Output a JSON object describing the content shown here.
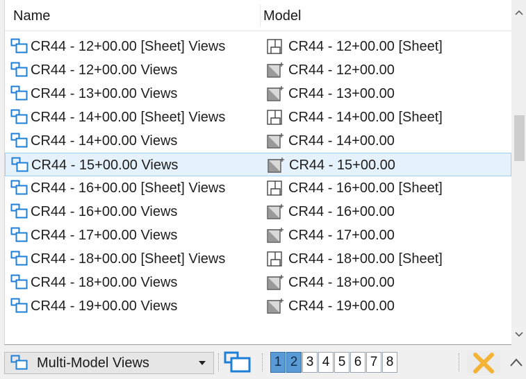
{
  "columns": {
    "name": "Name",
    "model": "Model"
  },
  "rows": [
    {
      "name": "CR44 - 12+00.00 [Sheet] Views",
      "model": "CR44 - 12+00.00 [Sheet]",
      "model_icon": "sheet-model-icon"
    },
    {
      "name": "CR44 - 12+00.00 Views",
      "model": "CR44 - 12+00.00",
      "model_icon": "drawing-model-icon"
    },
    {
      "name": "CR44 - 13+00.00 Views",
      "model": "CR44 - 13+00.00",
      "model_icon": "drawing-model-icon"
    },
    {
      "name": "CR44 - 14+00.00 [Sheet] Views",
      "model": "CR44 - 14+00.00 [Sheet]",
      "model_icon": "sheet-model-icon"
    },
    {
      "name": "CR44 - 14+00.00 Views",
      "model": "CR44 - 14+00.00",
      "model_icon": "drawing-model-icon"
    },
    {
      "name": "CR44 - 15+00.00 Views",
      "model": "CR44 - 15+00.00",
      "model_icon": "drawing-model-icon",
      "selected": true
    },
    {
      "name": "CR44 - 16+00.00 [Sheet] Views",
      "model": "CR44 - 16+00.00 [Sheet]",
      "model_icon": "sheet-model-icon"
    },
    {
      "name": "CR44 - 16+00.00 Views",
      "model": "CR44 - 16+00.00",
      "model_icon": "drawing-model-icon"
    },
    {
      "name": "CR44 - 17+00.00 Views",
      "model": "CR44 - 17+00.00",
      "model_icon": "drawing-model-icon"
    },
    {
      "name": "CR44 - 18+00.00 [Sheet] Views",
      "model": "CR44 - 18+00.00 [Sheet]",
      "model_icon": "sheet-model-icon"
    },
    {
      "name": "CR44 - 18+00.00 Views",
      "model": "CR44 - 18+00.00",
      "model_icon": "drawing-model-icon"
    },
    {
      "name": "CR44 - 19+00.00 Views",
      "model": "CR44 - 19+00.00",
      "model_icon": "drawing-model-icon"
    }
  ],
  "toolbar": {
    "mode_select": "Multi-Model Views",
    "view_numbers": [
      "1",
      "2",
      "3",
      "4",
      "5",
      "6",
      "7",
      "8"
    ],
    "active_views": [
      "1",
      "2"
    ]
  },
  "colors": {
    "view_icon": "#1e7fd8",
    "active_view_button": "#5b9bd5",
    "selection": "#e5f1fb",
    "clear_icon": "#f5b335"
  }
}
